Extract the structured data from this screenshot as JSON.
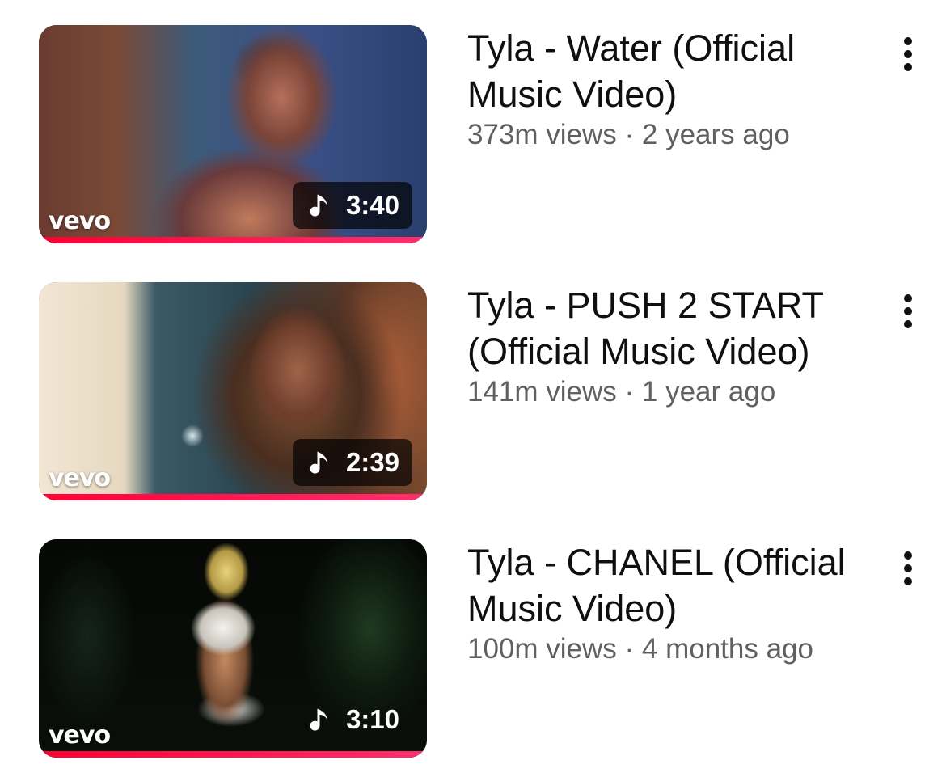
{
  "videos": [
    {
      "title": "Tyla - Water (Official Music Video)",
      "stats": "373m views · 2 years ago",
      "duration": "3:40",
      "channel_logo": "vevo",
      "watch_progress": 1.0
    },
    {
      "title": "Tyla - PUSH 2 START (Official Music Video)",
      "stats": "141m views · 1 year ago",
      "duration": "2:39",
      "channel_logo": "vevo",
      "watch_progress": 1.0
    },
    {
      "title": "Tyla - CHANEL (Official Music Video)",
      "stats": "100m views · 4 months ago",
      "duration": "3:10",
      "channel_logo": "vevo",
      "watch_progress": 1.0
    }
  ],
  "icons": {
    "duration": "music-note-icon",
    "menu": "more-vert-icon"
  },
  "colors": {
    "progress": "#ff0033",
    "title": "#0f0f0f",
    "subtitle": "#606060"
  }
}
